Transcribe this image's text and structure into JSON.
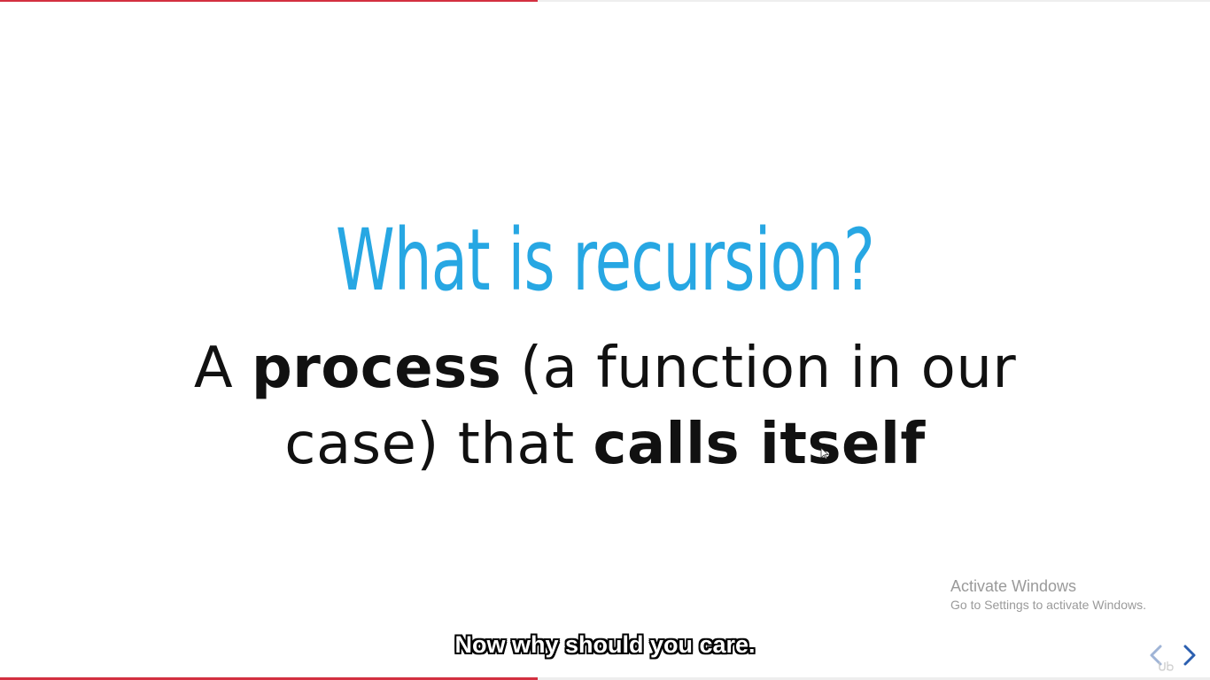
{
  "slide": {
    "title": "What is recursion?",
    "body": {
      "part1": "A ",
      "bold1": "process",
      "part2": " (a function in our case) that ",
      "bold2": "calls itself"
    },
    "title_color": "#27a7e3",
    "body_color": "#111111"
  },
  "caption": {
    "text": "Now why should you care."
  },
  "watermark": {
    "title": "Activate Windows",
    "subtitle": "Go to Settings to activate Windows."
  },
  "player": {
    "progress_fraction": 0.444,
    "progress_color": "#d33040",
    "prev_icon": "chevron-left-icon",
    "next_icon": "chevron-right-icon",
    "brand_icon": "udemy-logo-icon"
  }
}
